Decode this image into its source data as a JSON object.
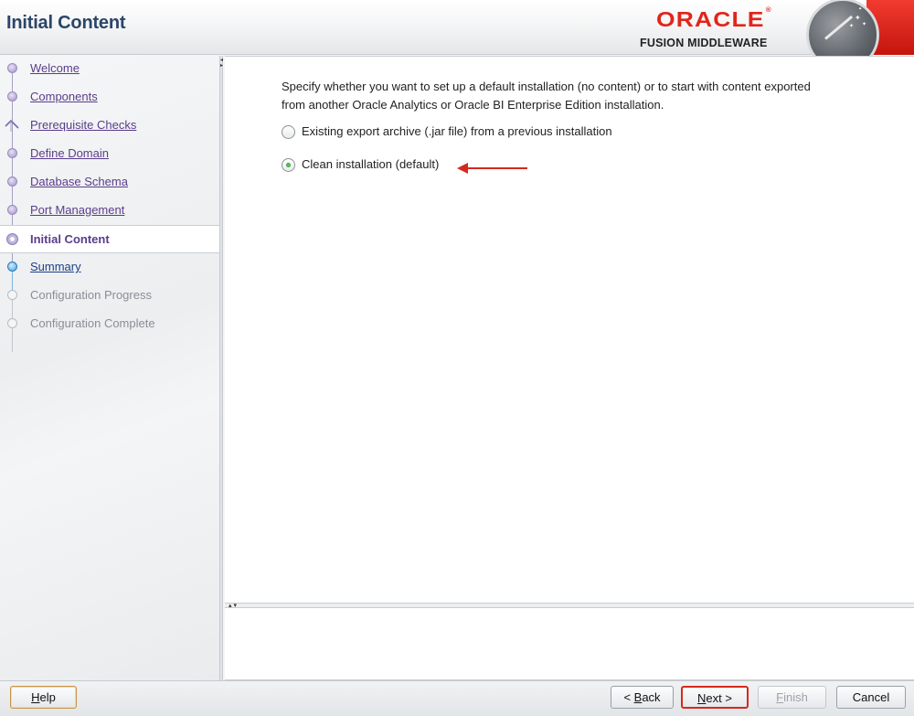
{
  "header": {
    "title": "Initial Content",
    "logo_brand": "ORACLE",
    "logo_registered": "®",
    "logo_product": "FUSION MIDDLEWARE"
  },
  "nav": {
    "items": [
      {
        "label": "Welcome",
        "state": "done"
      },
      {
        "label": "Components",
        "state": "done"
      },
      {
        "label": "Prerequisite Checks",
        "state": "done-check"
      },
      {
        "label": "Define Domain",
        "state": "done"
      },
      {
        "label": "Database Schema",
        "state": "done"
      },
      {
        "label": "Port Management",
        "state": "done"
      },
      {
        "label": "Initial Content",
        "state": "current"
      },
      {
        "label": "Summary",
        "state": "next"
      },
      {
        "label": "Configuration Progress",
        "state": "disabled"
      },
      {
        "label": "Configuration Complete",
        "state": "disabled"
      }
    ]
  },
  "main": {
    "description_line1": "Specify whether you want to set up a default installation (no content) or to start with content exported",
    "description_line2": "from another Oracle Analytics or Oracle BI Enterprise Edition installation.",
    "options": [
      {
        "label": "Existing export archive (.jar file) from a previous installation",
        "selected": false
      },
      {
        "label": "Clean installation (default)",
        "selected": true
      }
    ]
  },
  "buttons": {
    "help": {
      "mnemonic": "H",
      "rest": "elp"
    },
    "back": {
      "prefix": "< ",
      "mnemonic": "B",
      "rest": "ack"
    },
    "next": {
      "mnemonic": "N",
      "rest": "ext >"
    },
    "finish": {
      "mnemonic": "F",
      "rest": "inish"
    },
    "cancel": "Cancel"
  },
  "colors": {
    "brand_red": "#e1251b",
    "title_blue": "#2c4568",
    "nav_link": "#5a3d8a",
    "highlight_red": "#d42a1d"
  }
}
